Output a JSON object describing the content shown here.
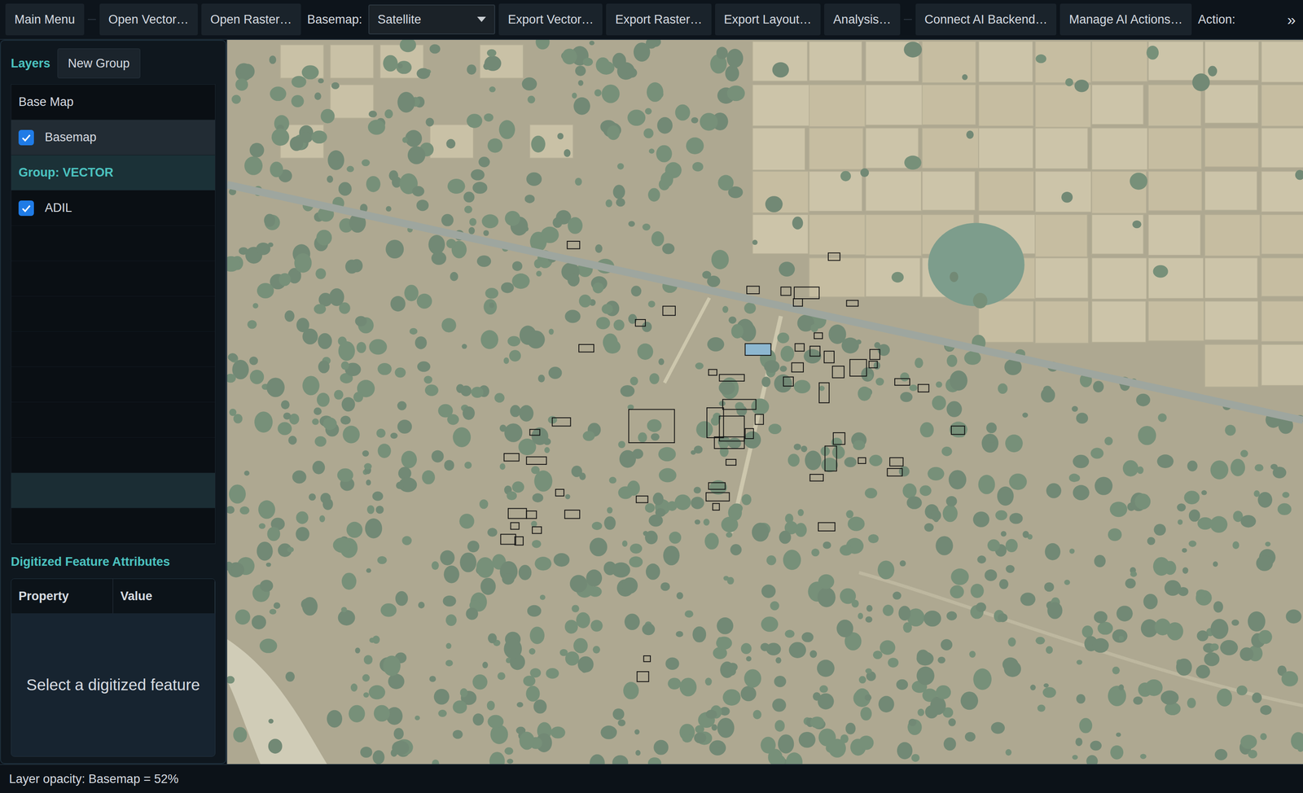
{
  "toolbar": {
    "items": [
      {
        "kind": "button",
        "label": "Main Menu"
      },
      {
        "kind": "separator"
      },
      {
        "kind": "button",
        "label": "Open Vector…"
      },
      {
        "kind": "button",
        "label": "Open Raster…"
      },
      {
        "kind": "label",
        "label": "Basemap:"
      },
      {
        "kind": "dropdown",
        "label": "Satellite"
      },
      {
        "kind": "button",
        "label": "Export Vector…"
      },
      {
        "kind": "button",
        "label": "Export Raster…"
      },
      {
        "kind": "button",
        "label": "Export Layout…"
      },
      {
        "kind": "button",
        "label": "Analysis…"
      },
      {
        "kind": "separator"
      },
      {
        "kind": "button",
        "label": "Connect AI Backend…"
      },
      {
        "kind": "button",
        "label": "Manage AI Actions…"
      },
      {
        "kind": "label",
        "label": "Action:"
      }
    ],
    "overflow": "»"
  },
  "sidebar": {
    "title": "Layers",
    "new_group_button": "New Group",
    "layers": [
      {
        "kind": "header",
        "label": "Base Map",
        "selected": false
      },
      {
        "kind": "layer",
        "label": "Basemap",
        "checked": true,
        "selected": true
      },
      {
        "kind": "group",
        "label": "Group: VECTOR",
        "selected": false
      },
      {
        "kind": "layer",
        "label": "ADIL",
        "checked": true,
        "selected": false
      },
      {
        "kind": "empty",
        "selected": false
      },
      {
        "kind": "empty",
        "selected": false
      },
      {
        "kind": "empty",
        "selected": false
      },
      {
        "kind": "empty",
        "selected": false
      },
      {
        "kind": "empty",
        "selected": false
      },
      {
        "kind": "empty",
        "selected": false
      },
      {
        "kind": "empty",
        "selected": false
      },
      {
        "kind": "empty",
        "selected": true
      },
      {
        "kind": "empty",
        "selected": false
      }
    ]
  },
  "attributes": {
    "title": "Digitized Feature Attributes",
    "columns": [
      "Property",
      "Value"
    ],
    "placeholder": "Select a digitized feature"
  },
  "map": {
    "basemap_opacity": 0.52
  },
  "status_bar": "Layer opacity: Basemap = 52%"
}
